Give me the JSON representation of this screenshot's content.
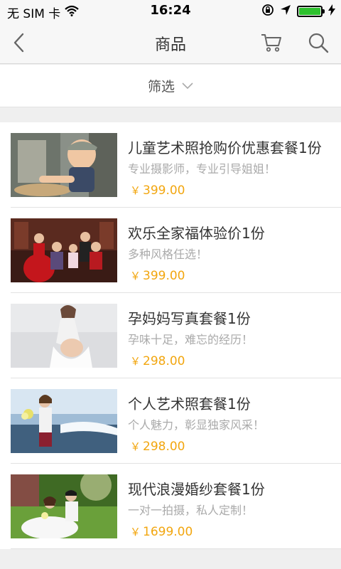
{
  "status_bar": {
    "carrier": "无 SIM 卡",
    "time": "16:24",
    "battery_color": "#2ec12e"
  },
  "nav": {
    "title": "商品",
    "back_icon": "chevron-left-icon",
    "cart_icon": "cart-icon",
    "search_icon": "search-icon"
  },
  "filter": {
    "label": "筛选",
    "icon": "chevron-down-icon"
  },
  "currency_symbol": "￥",
  "products": [
    {
      "name": "儿童艺术照抢购价优惠套餐1份",
      "desc": "专业摄影师，专业引导姐姐！",
      "price": "399.00"
    },
    {
      "name": "欢乐全家福体验价1份",
      "desc": "多种风格任选！",
      "price": "399.00"
    },
    {
      "name": "孕妈妈写真套餐1份",
      "desc": "孕味十足，难忘的经历！",
      "price": "298.00"
    },
    {
      "name": "个人艺术照套餐1份",
      "desc": "个人魅力，彰显独家风采！",
      "price": "298.00"
    },
    {
      "name": "现代浪漫婚纱套餐1份",
      "desc": "一对一拍摄，私人定制！",
      "price": "1699.00"
    }
  ],
  "colors": {
    "price": "#f2a60f",
    "background": "#efefef",
    "bar": "#f7f7f7"
  }
}
